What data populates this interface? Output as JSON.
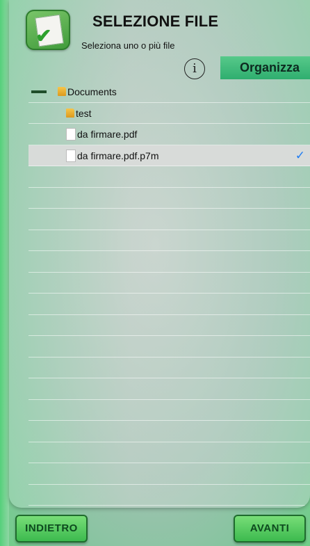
{
  "header": {
    "title": "SELEZIONE FILE",
    "subtitle": "Seleziona uno o più file",
    "info_label": "i",
    "organize_label": "Organizza"
  },
  "tree": [
    {
      "label": "Documents",
      "type": "folder",
      "level": 0,
      "expanded": true,
      "selected": false
    },
    {
      "label": "test",
      "type": "folder",
      "level": 1,
      "selected": false
    },
    {
      "label": "da firmare.pdf",
      "type": "file",
      "level": 1,
      "selected": false
    },
    {
      "label": "da firmare.pdf.p7m",
      "type": "file",
      "level": 1,
      "selected": true
    }
  ],
  "footer": {
    "back_label": "INDIETRO",
    "next_label": "AVANTI"
  },
  "colors": {
    "accent_green": "#2fae6f",
    "check_blue": "#1e7cf2",
    "selected_row": "#d8dbd9"
  }
}
